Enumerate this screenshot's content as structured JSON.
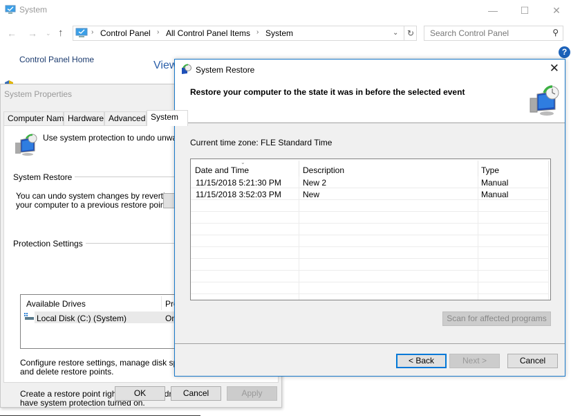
{
  "system_window": {
    "title": "System",
    "controls": {
      "minimize": "—",
      "maximize": "☐",
      "close": "✕"
    },
    "nav": {
      "back": "←",
      "forward": "→",
      "recent": "⌄",
      "up": "↑"
    },
    "breadcrumb": [
      "Control Panel",
      "All Control Panel Items",
      "System"
    ],
    "breadcrumb_separator": "›",
    "address_dropdown": "⌄",
    "refresh": "↻",
    "search": {
      "placeholder": "Search Control Panel",
      "icon": "⚲"
    },
    "sidebar": {
      "home_link": "Control Panel Home"
    },
    "view_heading_partial": "View",
    "help": "?"
  },
  "system_properties": {
    "title": "System Properties",
    "tabs": [
      {
        "label": "Computer Name",
        "active": false
      },
      {
        "label": "Hardware",
        "active": false
      },
      {
        "label": "Advanced",
        "active": false
      },
      {
        "label": "System",
        "active": true
      }
    ],
    "intro": "Use system protection to undo unwanted",
    "system_restore_group": "System Restore",
    "system_restore_text": [
      "You can undo system changes by reverting",
      "your computer to a previous restore point."
    ],
    "protection_group": "Protection Settings",
    "drives_table": {
      "headers": [
        "Available Drives",
        "Pro"
      ],
      "rows": [
        {
          "drive": "Local Disk (C:) (System)",
          "protection": "On"
        }
      ]
    },
    "configure_text": [
      "Configure restore settings, manage disk space,",
      "and delete restore points."
    ],
    "create_text": [
      "Create a restore point right now for the drives tha",
      "have system protection turned on."
    ],
    "buttons": {
      "ok": "OK",
      "cancel": "Cancel",
      "apply": "Apply"
    }
  },
  "system_restore": {
    "title": "System Restore",
    "close": "✕",
    "heading": "Restore your computer to the state it was in before the selected event",
    "timezone": "Current time zone: FLE Standard Time",
    "table": {
      "sort_indicator": "⌄",
      "headers": [
        "Date and Time",
        "Description",
        "Type"
      ],
      "rows": [
        {
          "date": "11/15/2018 5:21:30 PM",
          "description": "New 2",
          "type": "Manual"
        },
        {
          "date": "11/15/2018 3:52:03 PM",
          "description": "New",
          "type": "Manual"
        }
      ]
    },
    "scan_button": "Scan for affected programs",
    "buttons": {
      "back": "< Back",
      "next": "Next >",
      "cancel": "Cancel"
    }
  }
}
